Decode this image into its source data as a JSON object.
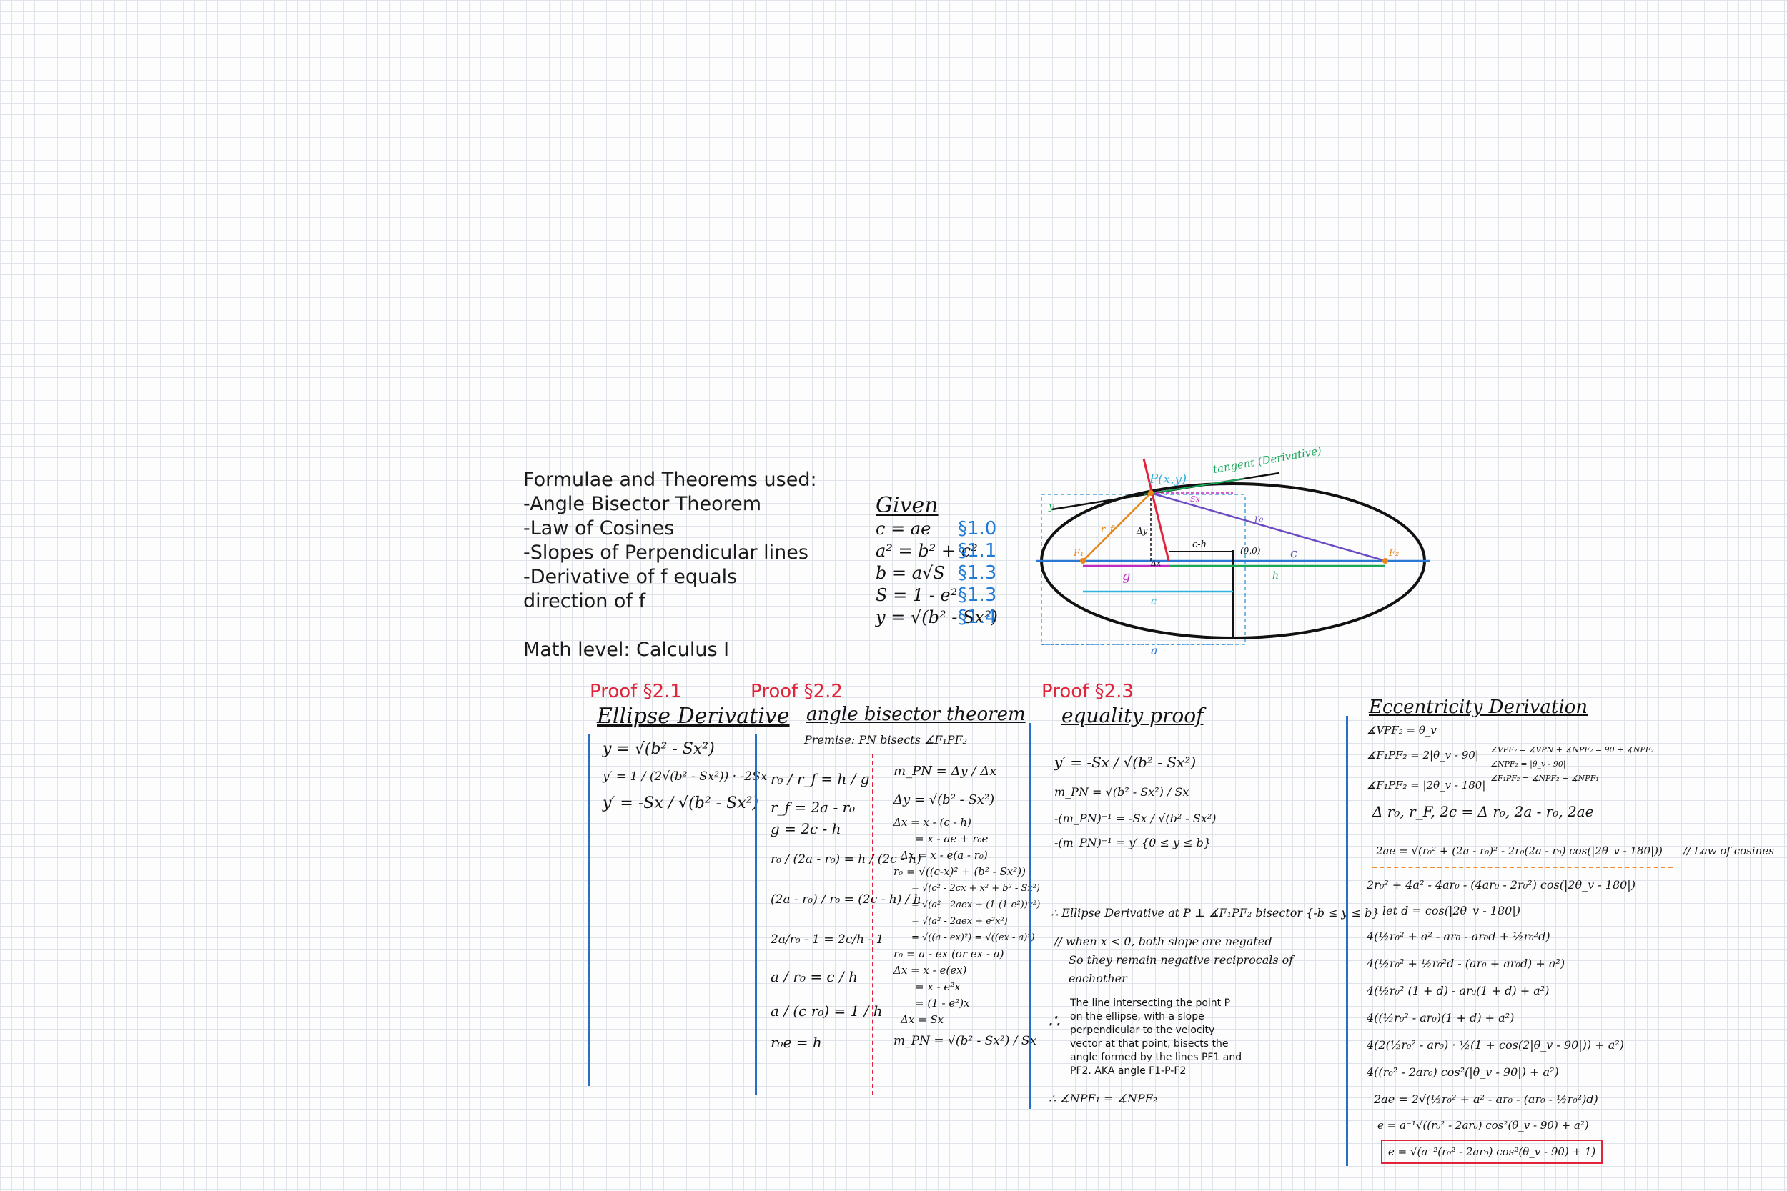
{
  "formulae": {
    "title": "Formulae and Theorems used:",
    "items": [
      "-Angle Bisector Theorem",
      "-Law of Cosines",
      "-Slopes of Perpendicular lines",
      "-Derivative of f equals",
      "direction of f"
    ],
    "math_level": "Math level: Calculus I"
  },
  "given": {
    "title": "Given",
    "rows": [
      {
        "expr": "c = ae",
        "ref": "§1.0"
      },
      {
        "expr": "a² = b² + c²",
        "ref": "§1.1"
      },
      {
        "expr": "b = a√S",
        "ref": "§1.3"
      },
      {
        "expr": "S = 1 - e²",
        "ref": "§1.3"
      },
      {
        "expr": "y = √(b² - Sx²)",
        "ref": "§1.4"
      }
    ]
  },
  "diagram": {
    "labels": {
      "p": "P(x,y)",
      "tangent": "tangent (Derivative)",
      "origin": "(0,0)",
      "c_minus_h": "c-h",
      "r0": "r₀",
      "rf": "r_f",
      "c": "c",
      "g": "g",
      "h": "h",
      "a": "a",
      "dy": "Δy",
      "dx": "Δx",
      "f1": "F₁",
      "f2": "F₂",
      "sx": "Sx",
      "y": "y"
    }
  },
  "proof21": {
    "label": "Proof §2.1",
    "heading": "Ellipse Derivative",
    "lines": [
      "y = √(b² - Sx²)",
      "y′ = 1 / (2√(b² - Sx²)) · -2Sx",
      "y′ = -Sx / √(b² - Sx²)"
    ]
  },
  "proof22": {
    "label": "Proof §2.2",
    "heading": "angle bisector theorem",
    "premise": "Premise:  PN bisects ∡F₁PF₂",
    "left": [
      "r₀ / r_f = h / g",
      "r_f = 2a - r₀",
      "g = 2c - h",
      "r₀ / (2a - r₀) = h / (2c - h)",
      "(2a - r₀) / r₀ = (2c - h) / h",
      "2a/r₀ - 1 = 2c/h - 1",
      "a / r₀ = c / h",
      "a / (c r₀) = 1 / h",
      "r₀e = h"
    ],
    "right": [
      "m_PN = Δy / Δx",
      "Δy = √(b² - Sx²)",
      "Δx = x - (c - h)",
      "= x - ae + r₀e",
      "Δx = x - e(a - r₀)",
      "r₀ = √((c-x)² + (b² - Sx²))",
      "= √(c² - 2cx + x² + b² - Sx²)",
      "= √(a² - 2aex + (1-(1-e²))x²)",
      "= √(a² - 2aex + e²x²)",
      "= √((a - ex)²) = √((ex - a)²)",
      "r₀ = a - ex   (or ex - a)",
      "Δx = x - e(ex)",
      "= x - e²x",
      "= (1 - e²)x",
      "Δx = Sx",
      "m_PN = √(b² - Sx²) / Sx"
    ]
  },
  "proof23": {
    "label": "Proof §2.3",
    "heading": "equality proof",
    "lines": [
      "y′ = -Sx / √(b² - Sx²)",
      "m_PN = √(b² - Sx²) / Sx",
      "-(m_PN)⁻¹ = -Sx / √(b² - Sx²)",
      "-(m_PN)⁻¹ = y′ {0 ≤ y ≤ b}"
    ],
    "conclusion1": "∴ Ellipse Derivative at P ⊥ ∡F₁PF₂ bisector {-b ≤ y ≤ b}",
    "comment": [
      "// when x < 0, both slope are negated",
      "So they remain negative reciprocals of",
      "eachother"
    ],
    "para": [
      "The line intersecting the point P",
      "on the ellipse, with a slope",
      "perpendicular to the velocity",
      "vector at that point, bisects the",
      "angle formed by the lines PF1 and",
      "PF2. AKA angle F1-P-F2"
    ],
    "conclusion2": "∴ ∡NPF₁ = ∡NPF₂"
  },
  "ecc": {
    "heading": "Eccentricity Derivation",
    "left": [
      "∡VPF₂ = θ_v",
      "∡F₁PF₂ = 2|θ_v - 90|",
      "∡F₁PF₂ = |2θ_v - 180|"
    ],
    "right": [
      "∡VPF₂ = ∡VPN + ∡NPF₂ = 90 + ∡NPF₂",
      "∡NPF₂ = |θ_v - 90|",
      "∡F₁PF₂ = ∡NPF₂ + ∡NPF₁"
    ],
    "triangle": "Δ r₀, r_F, 2c = Δ r₀, 2a - r₀, 2ae",
    "law": "2ae = √(r₀² + (2a - r₀)² - 2r₀(2a - r₀) cos(|2θ_v - 180|))",
    "law_comment": "// Law of cosines",
    "lines": [
      "2r₀² + 4a² - 4ar₀ - (4ar₀ - 2r₀²) cos(|2θ_v - 180|)",
      "let d = cos(|2θ_v - 180|)",
      "4(½r₀² + a² - ar₀ - ar₀d + ½r₀²d)",
      "4(½r₀² + ½r₀²d - (ar₀ + ar₀d) + a²)",
      "4(½r₀² (1 + d) - ar₀(1 + d) + a²)",
      "4((½r₀² - ar₀)(1 + d) + a²)",
      "4(2(½r₀² - ar₀) · ½(1 + cos(2|θ_v - 90|)) + a²)",
      "4((r₀² - 2ar₀) cos²(|θ_v - 90|) + a²)",
      "2ae = 2√(½r₀² + a² - ar₀ - (ar₀ - ½r₀²)d)",
      "e = a⁻¹√((r₀² - 2ar₀) cos²(θ_v - 90) + a²)"
    ],
    "final": "e = √(a⁻²(r₀² - 2ar₀) cos²(θ_v - 90) + 1)"
  }
}
